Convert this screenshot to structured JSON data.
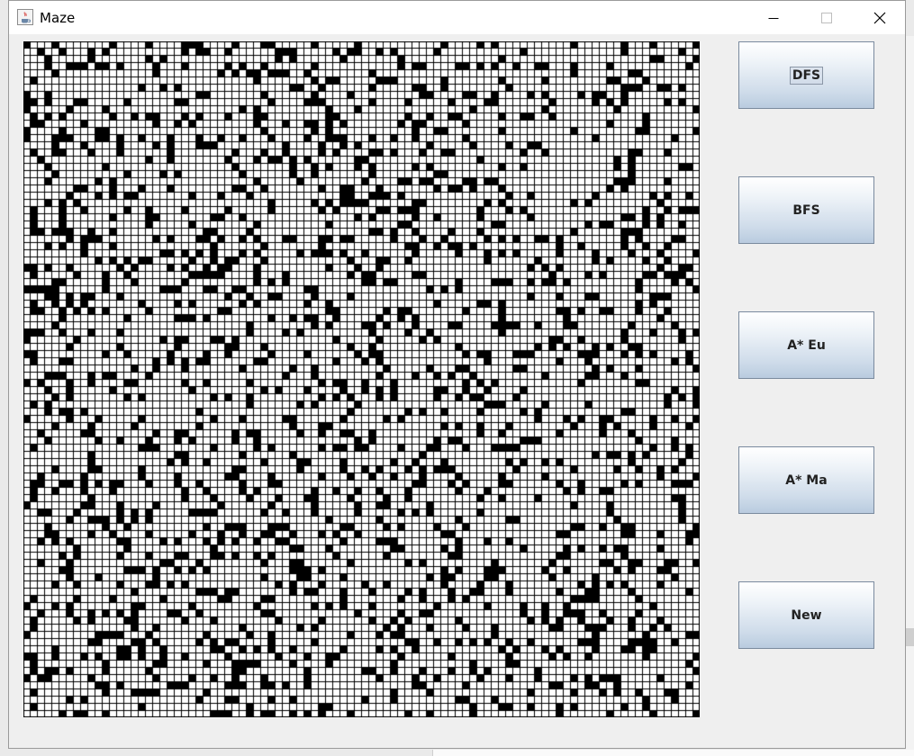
{
  "window": {
    "title": "Maze",
    "controls": {
      "minimize_icon": "minimize-icon",
      "maximize_icon": "maximize-icon",
      "close_icon": "close-icon"
    }
  },
  "maze": {
    "rows": 94,
    "cols": 94,
    "wall_color": "#000000",
    "open_color": "#ffffff",
    "grid_color": "#000000",
    "wall_density": 0.2,
    "seed": 20240607
  },
  "buttons": [
    {
      "id": "dfs",
      "label": "DFS",
      "focused": true
    },
    {
      "id": "bfs",
      "label": "BFS",
      "focused": false
    },
    {
      "id": "a-star-eu",
      "label": "A* Eu",
      "focused": false
    },
    {
      "id": "a-star-ma",
      "label": "A* Ma",
      "focused": false
    },
    {
      "id": "new",
      "label": "New",
      "focused": false
    }
  ]
}
